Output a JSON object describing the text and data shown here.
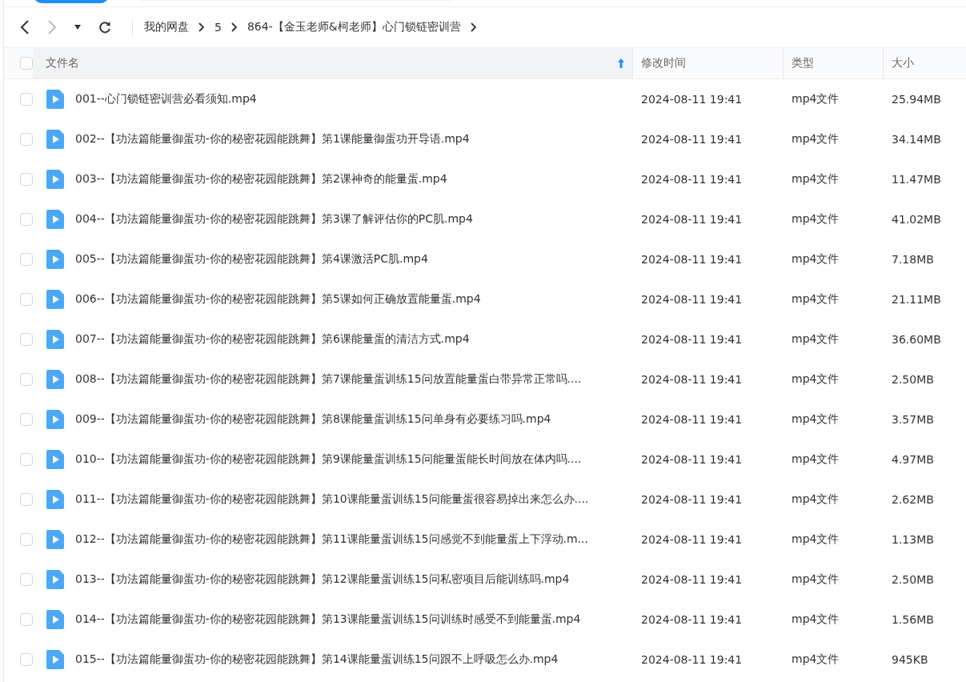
{
  "toolbar": {
    "back_enabled": true,
    "forward_enabled": false
  },
  "breadcrumb": [
    "我的网盘",
    "5",
    "864-【金玉老师&柯老师】心门锁链密训营"
  ],
  "table": {
    "columns": [
      {
        "label": "文件名",
        "sorted": true
      },
      {
        "label": "修改时间",
        "sorted": false
      },
      {
        "label": "类型",
        "sorted": false
      },
      {
        "label": "大小",
        "sorted": false
      }
    ],
    "all_checked": false,
    "rows": [
      {
        "name": "001--心门锁链密训营必看须知.mp4",
        "modified": "2024-08-11 19:41",
        "type": "mp4文件",
        "size": "25.94MB",
        "checked": false
      },
      {
        "name": "002--【功法篇能量御蛋功-你的秘密花园能跳舞】第1课能量御蛋功开导语.mp4",
        "modified": "2024-08-11 19:41",
        "type": "mp4文件",
        "size": "34.14MB",
        "checked": false
      },
      {
        "name": "003--【功法篇能量御蛋功-你的秘密花园能跳舞】第2课神奇的能量蛋.mp4",
        "modified": "2024-08-11 19:41",
        "type": "mp4文件",
        "size": "11.47MB",
        "checked": false
      },
      {
        "name": "004--【功法篇能量御蛋功-你的秘密花园能跳舞】第3课了解评估你的PC肌.mp4",
        "modified": "2024-08-11 19:41",
        "type": "mp4文件",
        "size": "41.02MB",
        "checked": false
      },
      {
        "name": "005--【功法篇能量御蛋功-你的秘密花园能跳舞】第4课激活PC肌.mp4",
        "modified": "2024-08-11 19:41",
        "type": "mp4文件",
        "size": "7.18MB",
        "checked": false
      },
      {
        "name": "006--【功法篇能量御蛋功-你的秘密花园能跳舞】第5课如何正确放置能量蛋.mp4",
        "modified": "2024-08-11 19:41",
        "type": "mp4文件",
        "size": "21.11MB",
        "checked": false
      },
      {
        "name": "007--【功法篇能量御蛋功-你的秘密花园能跳舞】第6课能量蛋的清洁方式.mp4",
        "modified": "2024-08-11 19:41",
        "type": "mp4文件",
        "size": "36.60MB",
        "checked": false
      },
      {
        "name": "008--【功法篇能量御蛋功-你的秘密花园能跳舞】第7课能量蛋训练15问放置能量蛋白带异常正常吗....",
        "modified": "2024-08-11 19:41",
        "type": "mp4文件",
        "size": "2.50MB",
        "checked": false
      },
      {
        "name": "009--【功法篇能量御蛋功-你的秘密花园能跳舞】第8课能量蛋训练15问单身有必要练习吗.mp4",
        "modified": "2024-08-11 19:41",
        "type": "mp4文件",
        "size": "3.57MB",
        "checked": false
      },
      {
        "name": "010--【功法篇能量御蛋功-你的秘密花园能跳舞】第9课能量蛋训练15问能量蛋能长时间放在体内吗....",
        "modified": "2024-08-11 19:41",
        "type": "mp4文件",
        "size": "4.97MB",
        "checked": false
      },
      {
        "name": "011--【功法篇能量御蛋功-你的秘密花园能跳舞】第10课能量蛋训练15问能量蛋很容易掉出来怎么办....",
        "modified": "2024-08-11 19:41",
        "type": "mp4文件",
        "size": "2.62MB",
        "checked": false
      },
      {
        "name": "012--【功法篇能量御蛋功-你的秘密花园能跳舞】第11课能量蛋训练15问感觉不到能量蛋上下浮动.m...",
        "modified": "2024-08-11 19:41",
        "type": "mp4文件",
        "size": "1.13MB",
        "checked": false
      },
      {
        "name": "013--【功法篇能量御蛋功-你的秘密花园能跳舞】第12课能量蛋训练15问私密项目后能训练吗.mp4",
        "modified": "2024-08-11 19:41",
        "type": "mp4文件",
        "size": "2.50MB",
        "checked": false
      },
      {
        "name": "014--【功法篇能量御蛋功-你的秘密花园能跳舞】第13课能量蛋训练15问训练时感受不到能量蛋.mp4",
        "modified": "2024-08-11 19:41",
        "type": "mp4文件",
        "size": "1.56MB",
        "checked": false
      },
      {
        "name": "015--【功法篇能量御蛋功-你的秘密花园能跳舞】第14课能量蛋训练15问跟不上呼吸怎么办.mp4",
        "modified": "2024-08-11 19:41",
        "type": "mp4文件",
        "size": "945KB",
        "checked": false
      }
    ]
  }
}
